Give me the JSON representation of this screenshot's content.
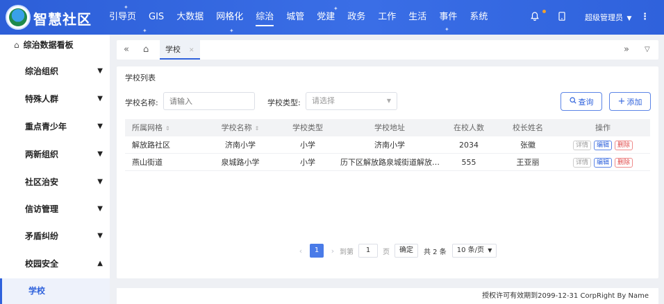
{
  "header": {
    "brand": "智慧社区",
    "nav": [
      "引导页",
      "GIS",
      "大数据",
      "网格化",
      "综治",
      "城管",
      "党建",
      "政务",
      "工作",
      "生活",
      "事件",
      "系统"
    ],
    "active_nav": "综治",
    "user": "超级管理员"
  },
  "sidebar": {
    "top_label": "综治数据看板",
    "items": [
      "综治组织",
      "特殊人群",
      "重点青少年",
      "两新组织",
      "社区治安",
      "信访管理",
      "矛盾纠纷",
      "校园安全"
    ],
    "sub_item": "学校"
  },
  "tabs": {
    "active": "学校"
  },
  "panel": {
    "title": "学校列表",
    "search": {
      "name_label": "学校名称:",
      "name_placeholder": "请输入",
      "type_label": "学校类型:",
      "type_placeholder": "请选择"
    },
    "buttons": {
      "query": "查询",
      "add": "添加"
    },
    "table": {
      "headers": [
        "所属网格",
        "学校名称",
        "学校类型",
        "学校地址",
        "在校人数",
        "校长姓名",
        "操作"
      ],
      "rows": [
        [
          "解放路社区",
          "济南小学",
          "小学",
          "济南小学",
          "2034",
          "张徽"
        ],
        [
          "燕山街道",
          "泉城路小学",
          "小学",
          "历下区解放路泉城街道解放…",
          "555",
          "王亚丽"
        ]
      ],
      "actions": {
        "detail": "详情",
        "edit": "编辑",
        "delete": "删除"
      }
    },
    "pager": {
      "current": "1",
      "goto_label": "到第",
      "goto_value": "1",
      "page_unit": "页",
      "confirm": "确定",
      "total": "共 2 条",
      "page_size": "10 条/页"
    }
  },
  "footer": {
    "text": "授权许可有效期到2099-12-31 CorpRight By Name"
  }
}
